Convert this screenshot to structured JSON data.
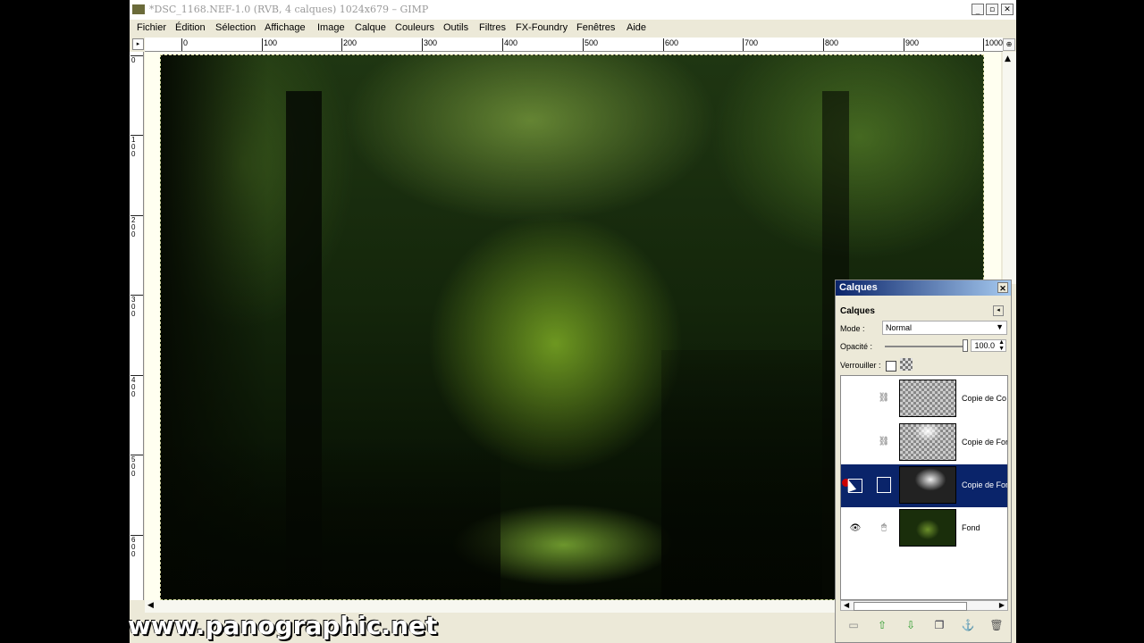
{
  "window": {
    "title": "*DSC_1168.NEF-1.0 (RVB, 4 calques) 1024x679 – GIMP",
    "controls": [
      "_",
      "▫",
      "✕"
    ]
  },
  "menu": [
    "Fichier",
    "Édition",
    "Sélection",
    "Affichage",
    "Image",
    "Calque",
    "Couleurs",
    "Outils",
    "Filtres",
    "FX-Foundry",
    "Fenêtres",
    "Aide"
  ],
  "rulers": {
    "horizontal_labels": [
      "0",
      "100",
      "200",
      "300",
      "400",
      "500",
      "600",
      "700",
      "800",
      "900",
      "1000"
    ],
    "vertical_labels": [
      "0",
      "100",
      "200",
      "300",
      "400",
      "500",
      "600"
    ]
  },
  "layers_dock": {
    "title": "Calques",
    "heading": "Calques",
    "mode_label": "Mode :",
    "mode_value": "Normal",
    "opacity_label": "Opacité :",
    "opacity_value": "100.0",
    "lock_label": "Verrouiller :",
    "layers": [
      {
        "name": "Copie de Co",
        "visible": false,
        "selected": false
      },
      {
        "name": "Copie de For",
        "visible": false,
        "selected": false
      },
      {
        "name": "Copie de For",
        "visible": false,
        "selected": true
      },
      {
        "name": "Fond",
        "visible": true,
        "selected": false
      }
    ],
    "buttons": [
      "new-layer-icon",
      "raise-layer-icon",
      "lower-layer-icon",
      "duplicate-layer-icon",
      "anchor-layer-icon",
      "delete-layer-icon"
    ]
  },
  "watermark": "www.panographic.net"
}
